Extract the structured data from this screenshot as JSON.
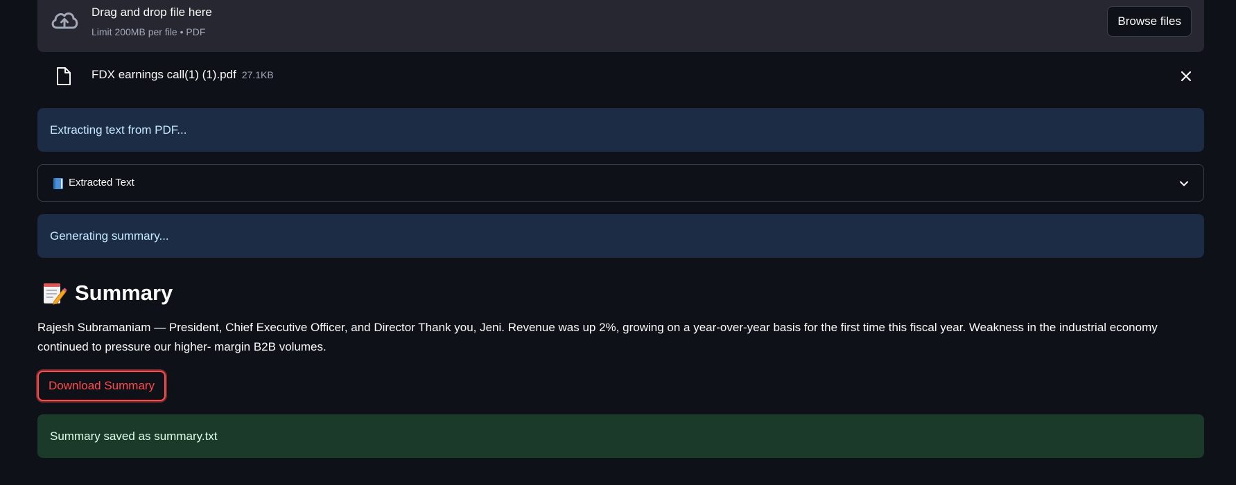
{
  "uploader": {
    "title": "Drag and drop file here",
    "limit": "Limit 200MB per file • PDF",
    "browse_label": "Browse files",
    "icon": "cloud-upload-icon"
  },
  "file": {
    "name": "FDX earnings call(1) (1).pdf",
    "size": "27.1KB",
    "icon": "file-icon"
  },
  "alerts": {
    "extracting": "Extracting text from PDF...",
    "generating": "Generating summary...",
    "saved": "Summary saved as summary.txt"
  },
  "expander": {
    "label": "Extracted Text",
    "icon": "book-icon"
  },
  "summary": {
    "title": "Summary",
    "icon": "memo-icon",
    "text": "Rajesh Subramaniam — President, Chief Executive Officer, and Director Thank you, Jeni. Revenue was up 2%, growing on a year-over-year basis for the first time this fiscal year. Weakness in the industrial economy continued to pressure our higher- margin B2B volumes.",
    "download_label": "Download Summary"
  },
  "colors": {
    "background": "#0e1117",
    "surface": "#262730",
    "info_bg": "#1c2c45",
    "success_bg": "#1b3a2a",
    "accent": "#ff4b4b"
  }
}
